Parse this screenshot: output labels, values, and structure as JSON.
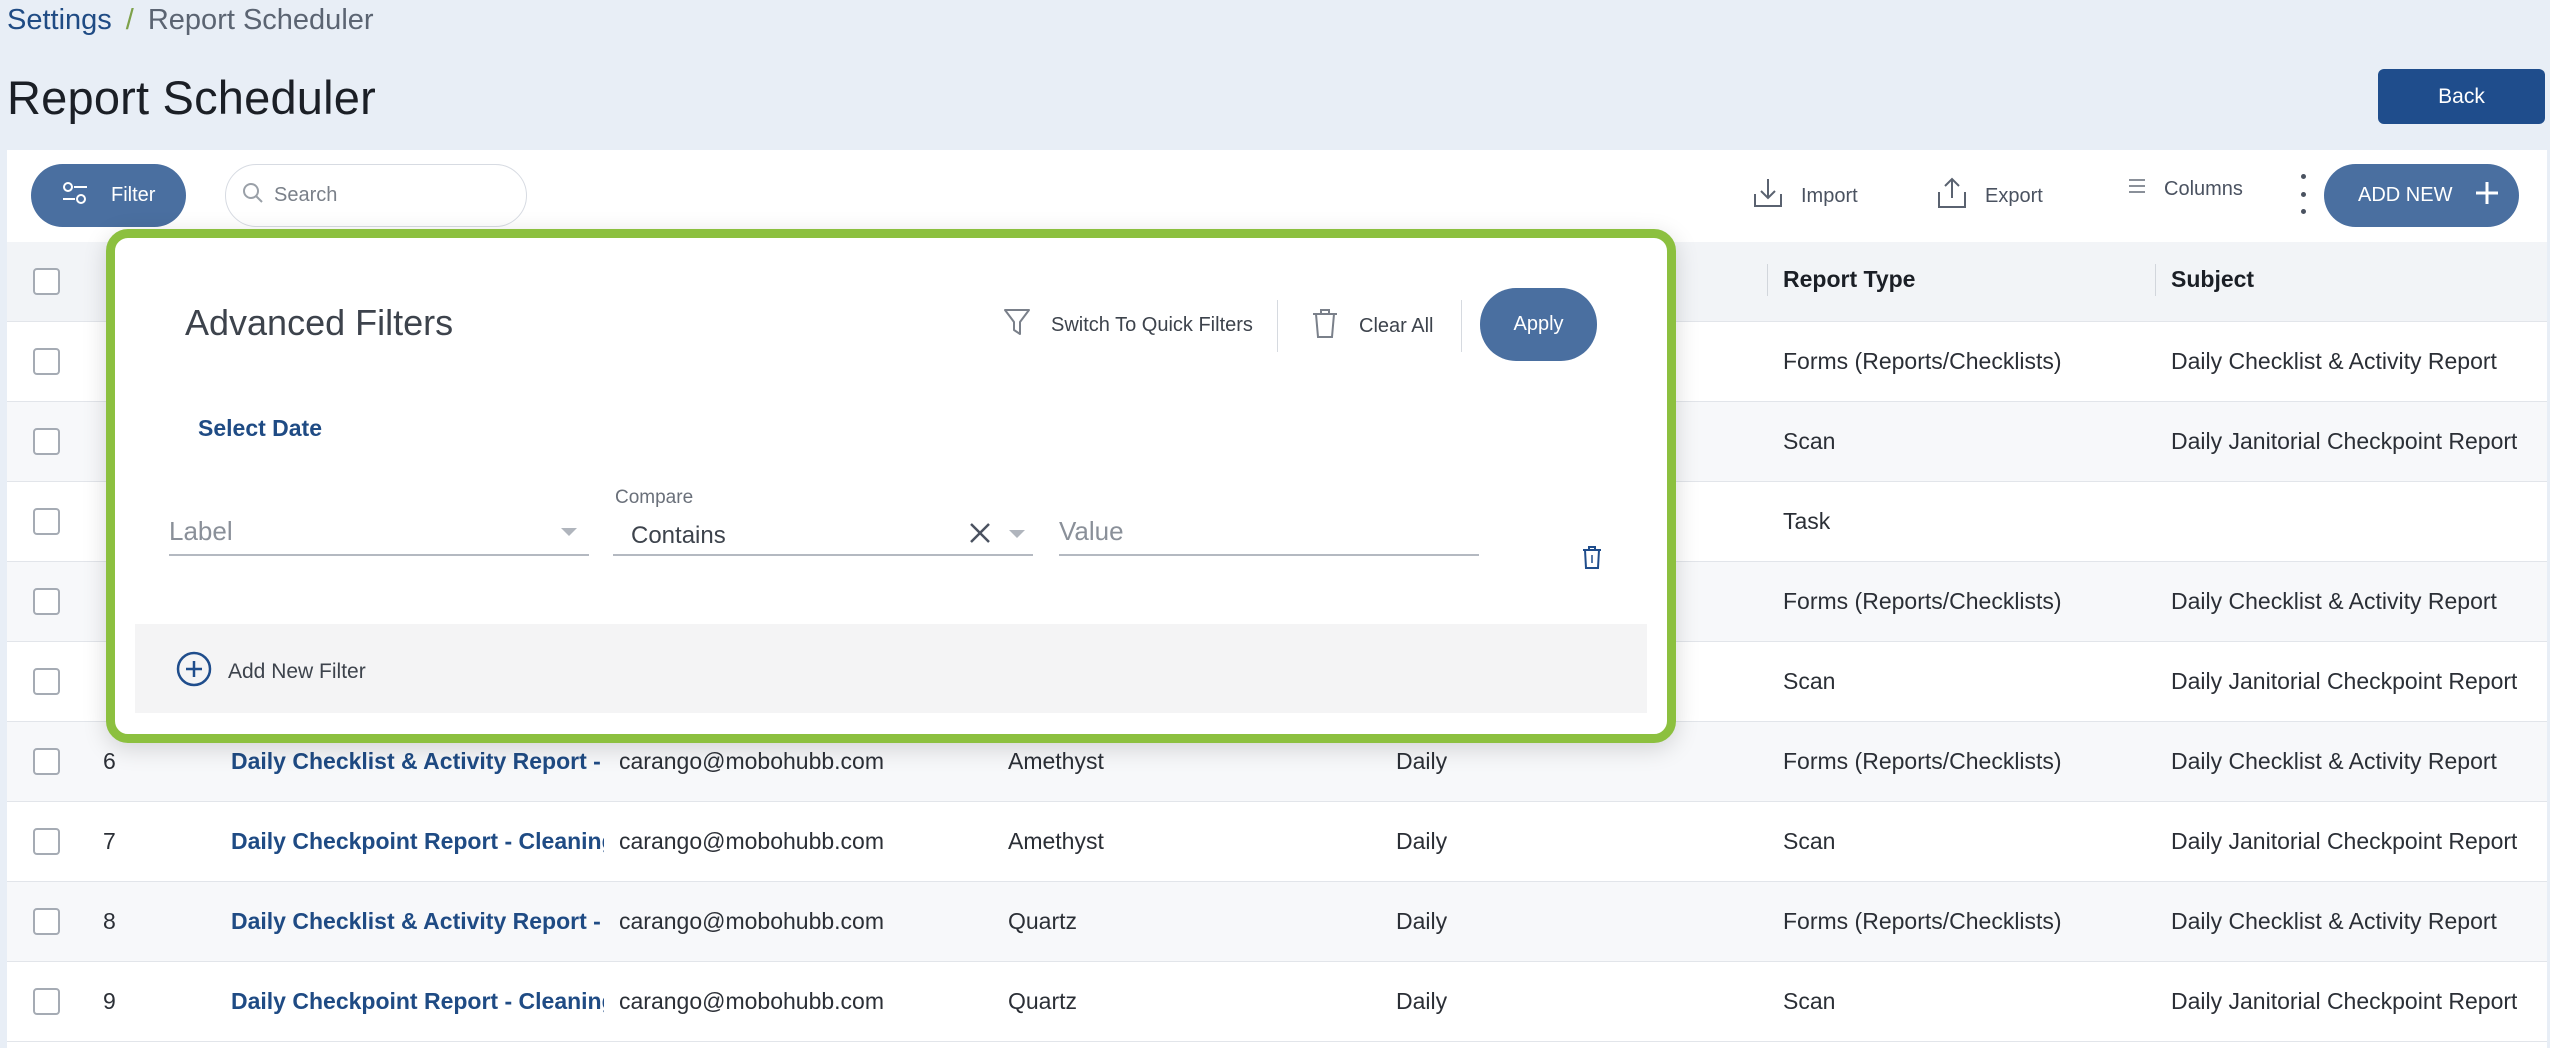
{
  "breadcrumb": {
    "parent": "Settings",
    "separator": "/",
    "current": "Report Scheduler"
  },
  "page_title": "Report Scheduler",
  "back_label": "Back",
  "toolbar": {
    "filter_label": "Filter",
    "search_placeholder": "Search",
    "import_label": "Import",
    "export_label": "Export",
    "columns_label": "Columns",
    "add_new_label": "ADD NEW"
  },
  "table": {
    "headers": {
      "report_type": "Report Type",
      "subject": "Subject"
    },
    "rows": [
      {
        "report_type": "Forms (Reports/Checklists)",
        "subject": "Daily Checklist & Activity Report"
      },
      {
        "report_type": "Scan",
        "subject": "Daily Janitorial Checkpoint Report"
      },
      {
        "report_type": "Task",
        "subject": ""
      },
      {
        "report_type": "Forms (Reports/Checklists)",
        "subject": "Daily Checklist & Activity Report"
      },
      {
        "report_type": "Scan",
        "subject": "Daily Janitorial Checkpoint Report"
      },
      {
        "num": "6",
        "name": "Daily Checklist & Activity Report - Cleaning",
        "email": "carango@mobohubb.com",
        "site": "Amethyst",
        "frequency": "Daily",
        "report_type": "Forms (Reports/Checklists)",
        "subject": "Daily Checklist & Activity Report"
      },
      {
        "num": "7",
        "name": "Daily Checkpoint Report - Cleaning",
        "email": "carango@mobohubb.com",
        "site": "Amethyst",
        "frequency": "Daily",
        "report_type": "Scan",
        "subject": "Daily Janitorial Checkpoint Report"
      },
      {
        "num": "8",
        "name": "Daily Checklist & Activity Report - Cleaning",
        "email": "carango@mobohubb.com",
        "site": "Quartz",
        "frequency": "Daily",
        "report_type": "Forms (Reports/Checklists)",
        "subject": "Daily Checklist & Activity Report"
      },
      {
        "num": "9",
        "name": "Daily Checkpoint Report - Cleaning",
        "email": "carango@mobohubb.com",
        "site": "Quartz",
        "frequency": "Daily",
        "report_type": "Scan",
        "subject": "Daily Janitorial Checkpoint Report"
      }
    ]
  },
  "advanced_filters": {
    "title": "Advanced Filters",
    "switch_label": "Switch To Quick Filters",
    "clear_all_label": "Clear All",
    "apply_label": "Apply",
    "select_date_label": "Select Date",
    "label_placeholder": "Label",
    "compare_label": "Compare",
    "compare_value": "Contains",
    "value_placeholder": "Value",
    "add_filter_label": "Add New Filter"
  },
  "colors": {
    "accent": "#4a6fa0",
    "primary": "#1f4d8c",
    "highlight_border": "#8cc03f",
    "link": "#1f4b84"
  }
}
